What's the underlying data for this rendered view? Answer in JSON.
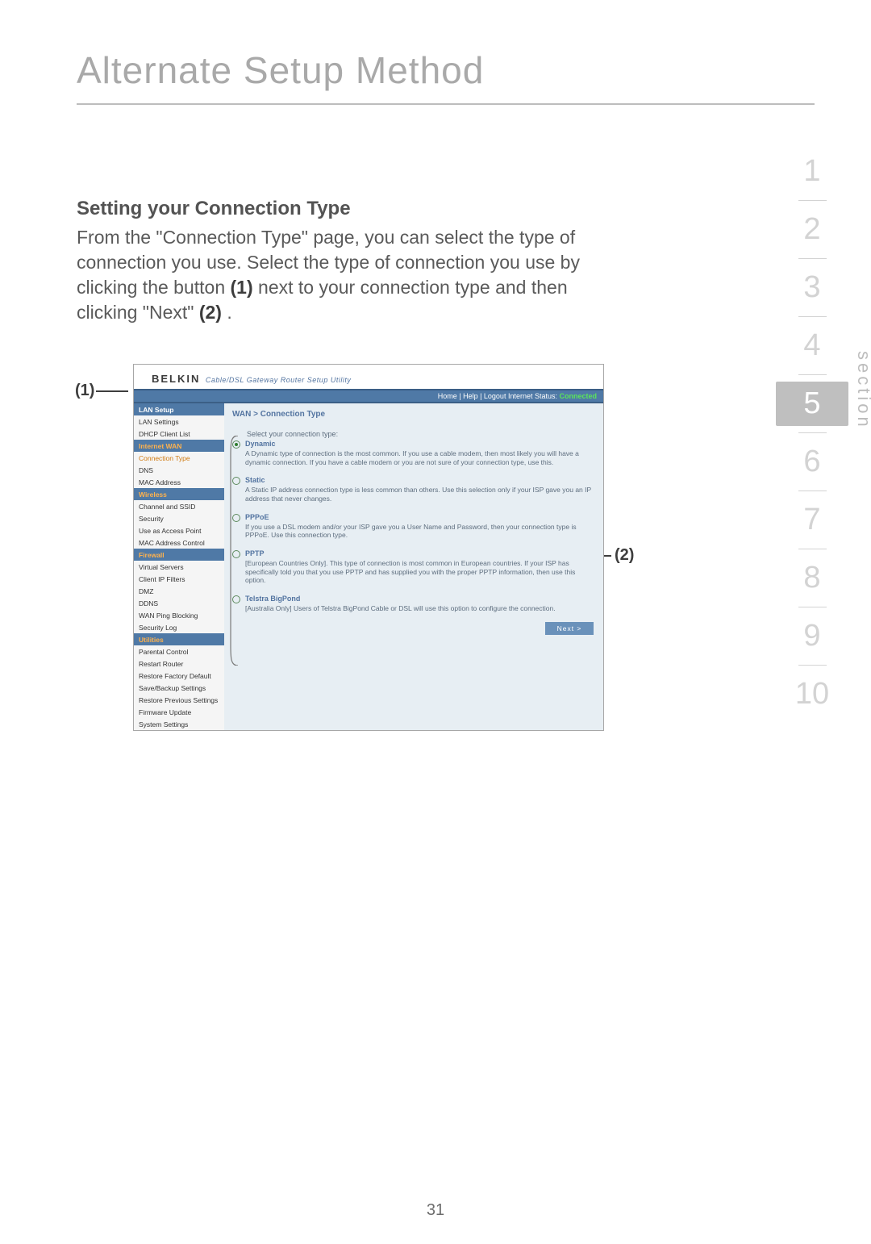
{
  "page": {
    "title": "Alternate Setup Method",
    "number": "31"
  },
  "content": {
    "heading": "Setting your Connection Type",
    "para_a": "From the \"Connection Type\" page, you can select the type of connection you use. Select the type of connection you use by clicking the button ",
    "para_bold1": "(1)",
    "para_b": " next to your connection type and then clicking \"Next\" ",
    "para_bold2": "(2)",
    "para_c": "."
  },
  "callouts": {
    "c1": "(1)",
    "c2": "(2)"
  },
  "section_index": {
    "label": "section",
    "items": [
      "1",
      "2",
      "3",
      "4",
      "5",
      "6",
      "7",
      "8",
      "9",
      "10"
    ],
    "current": "5"
  },
  "router": {
    "brand": "BELKIN",
    "brand_sub": "Cable/DSL Gateway Router Setup Utility",
    "topbar_links": "Home | Help | Logout   Internet Status: ",
    "topbar_status": "Connected",
    "breadcrumb": "WAN > Connection Type",
    "select_label": "Select your connection type:",
    "next_btn": "Next  >",
    "sidebar": [
      {
        "type": "hdr",
        "cls": "",
        "label": "LAN Setup"
      },
      {
        "type": "item",
        "cls": "",
        "label": "LAN Settings"
      },
      {
        "type": "item",
        "cls": "",
        "label": "DHCP Client List"
      },
      {
        "type": "hdr",
        "cls": "orange",
        "label": "Internet WAN"
      },
      {
        "type": "item",
        "cls": "orange",
        "label": "Connection Type"
      },
      {
        "type": "item",
        "cls": "",
        "label": "DNS"
      },
      {
        "type": "item",
        "cls": "",
        "label": "MAC Address"
      },
      {
        "type": "hdr",
        "cls": "orange",
        "label": "Wireless"
      },
      {
        "type": "item",
        "cls": "",
        "label": "Channel and SSID"
      },
      {
        "type": "item",
        "cls": "",
        "label": "Security"
      },
      {
        "type": "item",
        "cls": "",
        "label": "Use as Access Point"
      },
      {
        "type": "item",
        "cls": "",
        "label": "MAC Address Control"
      },
      {
        "type": "hdr",
        "cls": "orange",
        "label": "Firewall"
      },
      {
        "type": "item",
        "cls": "",
        "label": "Virtual Servers"
      },
      {
        "type": "item",
        "cls": "",
        "label": "Client IP Filters"
      },
      {
        "type": "item",
        "cls": "",
        "label": "DMZ"
      },
      {
        "type": "item",
        "cls": "",
        "label": "DDNS"
      },
      {
        "type": "item",
        "cls": "",
        "label": "WAN Ping Blocking"
      },
      {
        "type": "item",
        "cls": "",
        "label": "Security Log"
      },
      {
        "type": "hdr",
        "cls": "orange",
        "label": "Utilities"
      },
      {
        "type": "item",
        "cls": "",
        "label": "Parental Control"
      },
      {
        "type": "item",
        "cls": "",
        "label": "Restart Router"
      },
      {
        "type": "item",
        "cls": "",
        "label": "Restore Factory Default"
      },
      {
        "type": "item",
        "cls": "",
        "label": "Save/Backup Settings"
      },
      {
        "type": "item",
        "cls": "",
        "label": "Restore Previous Settings"
      },
      {
        "type": "item",
        "cls": "",
        "label": "Firmware Update"
      },
      {
        "type": "item",
        "cls": "",
        "label": "System Settings"
      }
    ],
    "options": [
      {
        "title": "Dynamic",
        "desc": "A Dynamic type of connection is the most common. If you use a cable modem, then most likely you will have a dynamic connection. If you have a cable modem or you are not sure of your connection type, use this.",
        "checked": true
      },
      {
        "title": "Static",
        "desc": "A Static IP address connection type is less common than others. Use this selection only if your ISP gave you an IP address that never changes.",
        "checked": false
      },
      {
        "title": "PPPoE",
        "desc": "If you use a DSL modem and/or your ISP gave you a User Name and Password, then your connection type is PPPoE. Use this connection type.",
        "checked": false
      },
      {
        "title": "PPTP",
        "desc": "[European Countries Only]. This type of connection is most common in European countries. If your ISP has specifically told you that you use PPTP and has supplied you with the proper PPTP information, then use this option.",
        "checked": false
      },
      {
        "title": "Telstra BigPond",
        "desc": "[Australia Only] Users of Telstra BigPond Cable or DSL will use this option to configure the connection.",
        "checked": false
      }
    ]
  }
}
